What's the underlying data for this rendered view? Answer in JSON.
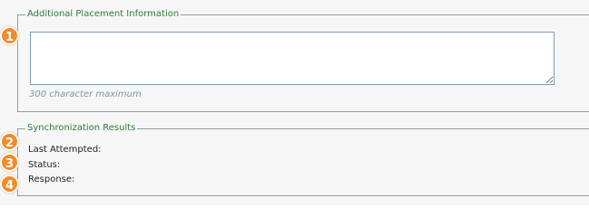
{
  "placement": {
    "legend": "Additional Placement Information",
    "textarea_value": "",
    "char_limit_note": "300 character maximum"
  },
  "sync": {
    "legend": "Synchronization Results",
    "last_attempted_label": "Last Attempted:",
    "status_label": "Status:",
    "response_label": "Response:"
  },
  "badges": {
    "b1": "1",
    "b2": "2",
    "b3": "3",
    "b4": "4"
  },
  "colors": {
    "legend_text": "#2f7a3a",
    "badge_fill": "#f28b27",
    "hint_text": "#7f93a6"
  }
}
